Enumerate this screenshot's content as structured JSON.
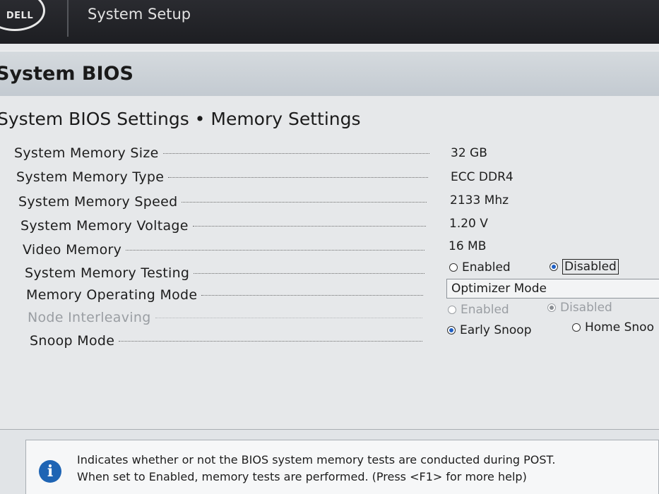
{
  "header": {
    "logo_text": "DELL",
    "app_title": "System Setup"
  },
  "page": {
    "title": "System BIOS",
    "breadcrumb": "System BIOS Settings • Memory Settings"
  },
  "settings": {
    "system_memory_size": {
      "label": "System Memory Size",
      "value": "32 GB"
    },
    "system_memory_type": {
      "label": "System Memory Type",
      "value": "ECC DDR4"
    },
    "system_memory_speed": {
      "label": "System Memory Speed",
      "value": "2133 Mhz"
    },
    "system_memory_voltage": {
      "label": "System Memory Voltage",
      "value": "1.20 V"
    },
    "video_memory": {
      "label": "Video Memory",
      "value": "16 MB"
    },
    "system_memory_testing": {
      "label": "System Memory Testing",
      "options": [
        "Enabled",
        "Disabled"
      ],
      "selected": "Disabled"
    },
    "memory_operating_mode": {
      "label": "Memory Operating Mode",
      "value": "Optimizer Mode"
    },
    "node_interleaving": {
      "label": "Node Interleaving",
      "options": [
        "Enabled",
        "Disabled"
      ],
      "selected": "Disabled",
      "disabled": true
    },
    "snoop_mode": {
      "label": "Snoop Mode",
      "options": [
        "Early Snoop",
        "Home Snoo"
      ],
      "selected": "Early Snoop"
    }
  },
  "help": {
    "line1": "Indicates whether or not the BIOS system memory tests are conducted during POST.",
    "line2": "When set to Enabled, memory tests are performed. (Press <F1> for more help)"
  },
  "colors": {
    "header_bg": "#1d1e22",
    "page_bg": "#e6e8ea",
    "radio_selected": "#1f5fc4",
    "info_icon": "#1e64b4"
  }
}
